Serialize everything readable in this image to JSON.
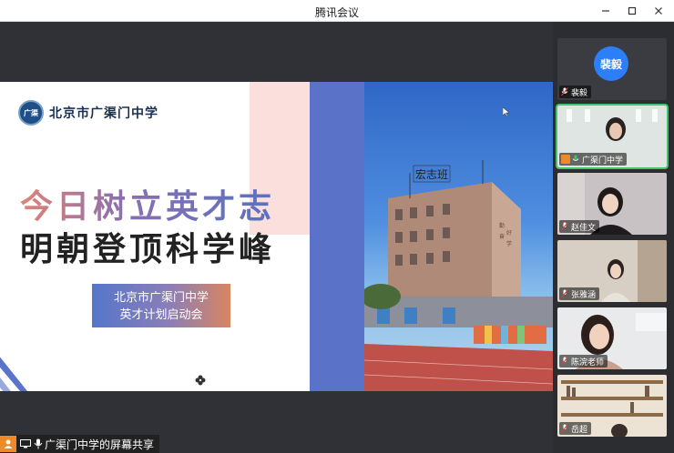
{
  "window": {
    "title": "腾讯会议"
  },
  "slide": {
    "school_name": "北京市广渠门中学",
    "seal_text": "广渠",
    "slogan_line1": "今日树立英才志",
    "slogan_line2": "明朝登顶科学峰",
    "event_line1": "北京市广渠门中学",
    "event_line2": "英才计划启动会",
    "building_sign": "宏志班"
  },
  "share": {
    "label": "广渠门中学的屏幕共享"
  },
  "participants": [
    {
      "name": "裴毅",
      "avatar_text": "裴毅",
      "type": "avatar",
      "color": "#2d7ff9"
    },
    {
      "name": "广渠门中学",
      "type": "video",
      "active": true
    },
    {
      "name": "赵佳文",
      "type": "video"
    },
    {
      "name": "张雅涵",
      "type": "video"
    },
    {
      "name": "陈浣老师",
      "type": "video"
    },
    {
      "name": "岳超",
      "type": "video"
    }
  ],
  "colors": {
    "accent": "#3ec46d",
    "share_icon": "#f08a24",
    "slide_blue": "#5a73c8"
  }
}
